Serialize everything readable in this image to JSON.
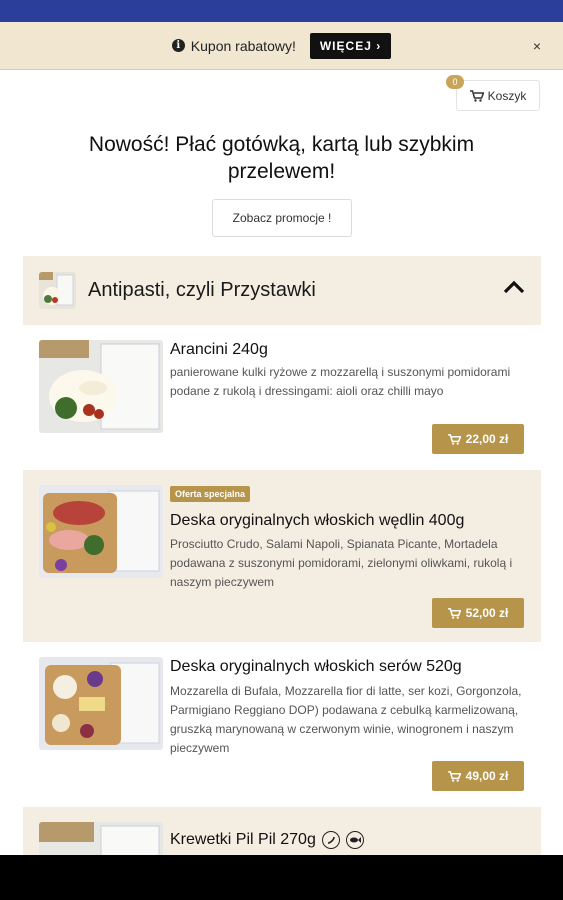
{
  "coupon": {
    "text": "Kupon rabatowy!",
    "button": "WIĘCEJ ›",
    "close": "×"
  },
  "cart": {
    "count": "0",
    "label": "Koszyk"
  },
  "headline": "Nowość! Płać gotówką, kartą lub szybkim przelewem!",
  "promo_button": "Zobacz promocje !",
  "category": {
    "title": "Antipasti, czyli Przystawki"
  },
  "items": [
    {
      "title": "Arancini 240g",
      "desc": "panierowane kulki ryżowe z mozzarellą i suszonymi pomidorami podane z rukolą i dressingami: aioli oraz chilli mayo",
      "price": "22,00 zł"
    },
    {
      "badge": "Oferta specjalna",
      "title": "Deska oryginalnych włoskich wędlin 400g",
      "desc": "Prosciutto Crudo, Salami Napoli, Spianata Picante, Mortadela podawana z suszonymi pomidorami, zielonymi oliwkami, rukolą i naszym pieczywem",
      "price": "52,00 zł"
    },
    {
      "title": "Deska oryginalnych włoskich serów 520g",
      "desc": "Mozzarella di Bufala, Mozzarella fior di latte, ser kozi, Gorgonzola, Parmigiano Reggiano DOP) podawana z cebulką karmelizowaną, gruszką marynowaną w czerwonym winie, winogronem i naszym pieczywem",
      "price": "49,00 zł"
    },
    {
      "title": "Krewetki Pil Pil 270g"
    }
  ],
  "colors": {
    "accent": "#b6944a",
    "category_bg": "#f4ede2",
    "coupon_bg": "#f1e7d1",
    "topbar": "#2b3f9a"
  },
  "icons": [
    "info-icon",
    "cart-icon",
    "chevron-up-icon",
    "chili-icon",
    "fish-icon"
  ]
}
